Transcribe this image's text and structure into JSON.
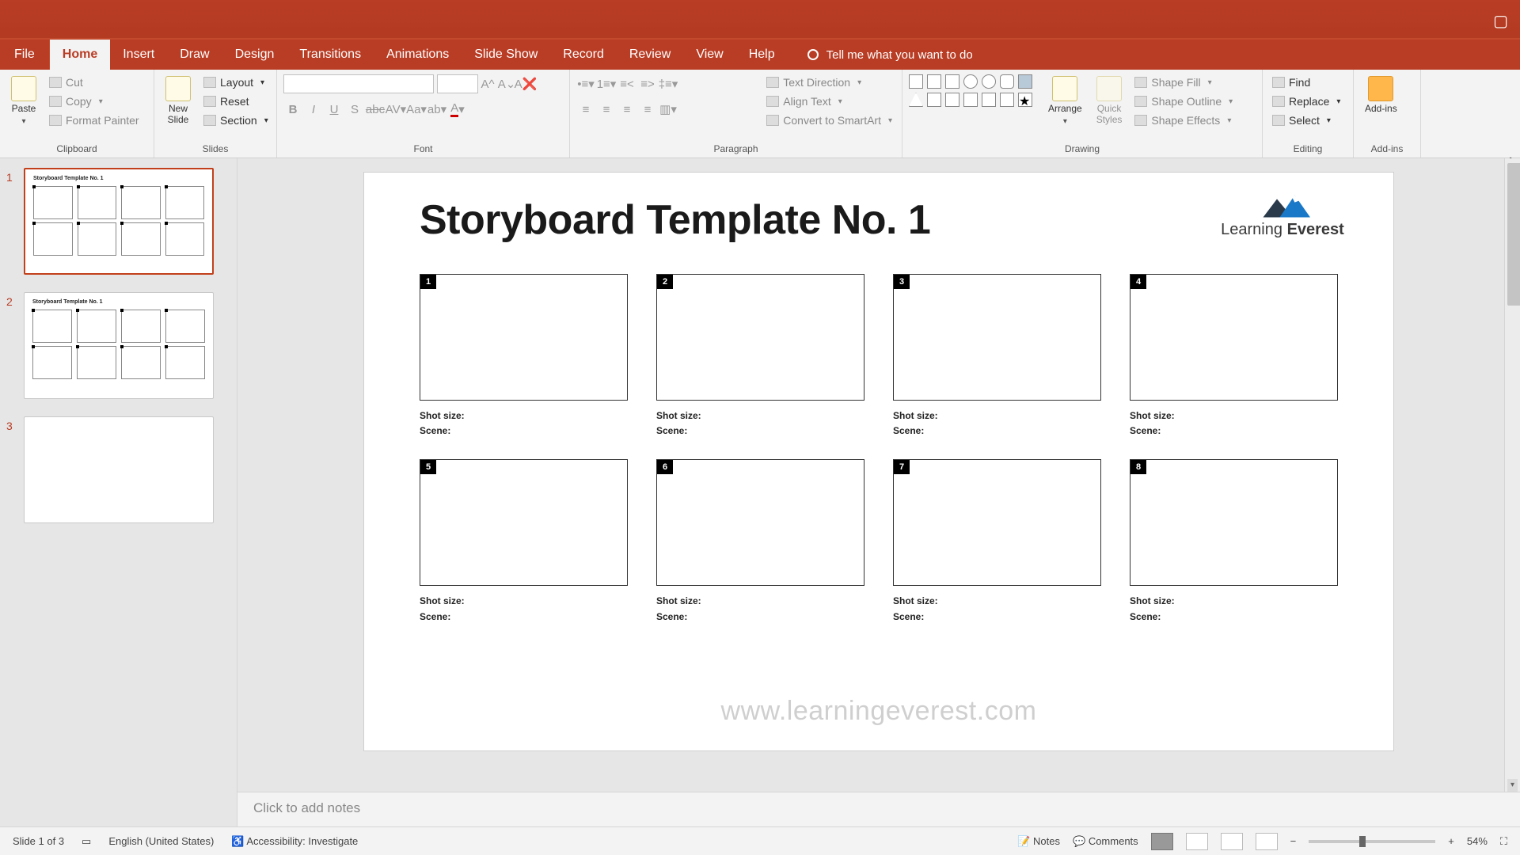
{
  "tabs": {
    "file": "File",
    "home": "Home",
    "insert": "Insert",
    "draw": "Draw",
    "design": "Design",
    "transitions": "Transitions",
    "animations": "Animations",
    "slideShow": "Slide Show",
    "record": "Record",
    "review": "Review",
    "view": "View",
    "help": "Help",
    "tellMe": "Tell me what you want to do"
  },
  "ribbon": {
    "clipboard": {
      "label": "Clipboard",
      "paste": "Paste",
      "cut": "Cut",
      "copy": "Copy",
      "formatPainter": "Format Painter"
    },
    "slides": {
      "label": "Slides",
      "newSlide": "New\nSlide",
      "layout": "Layout",
      "reset": "Reset",
      "section": "Section"
    },
    "font": {
      "label": "Font"
    },
    "para": {
      "label": "Paragraph",
      "textDirection": "Text Direction",
      "alignText": "Align Text",
      "smartArt": "Convert to SmartArt"
    },
    "drawing": {
      "label": "Drawing",
      "arrange": "Arrange",
      "quickStyles": "Quick\nStyles",
      "shapeFill": "Shape Fill",
      "shapeOutline": "Shape Outline",
      "shapeEffects": "Shape Effects"
    },
    "editing": {
      "label": "Editing",
      "find": "Find",
      "replace": "Replace",
      "select": "Select"
    },
    "addins": {
      "label": "Add-ins",
      "btn": "Add-ins"
    }
  },
  "thumbs": [
    {
      "num": "1",
      "title": "Storyboard Template No. 1",
      "layout": "storyboard",
      "active": true
    },
    {
      "num": "2",
      "title": "Storyboard Template No. 1",
      "layout": "storyboard",
      "active": false
    },
    {
      "num": "3",
      "title": "",
      "layout": "blank",
      "active": false
    }
  ],
  "slide": {
    "title": "Storyboard Template No. 1",
    "logoText": "Learning ",
    "logoBold": "Everest",
    "meta": {
      "shot": "Shot size:",
      "scene": "Scene:"
    },
    "cells": [
      "1",
      "2",
      "3",
      "4",
      "5",
      "6",
      "7",
      "8"
    ],
    "watermark": "www.learningeverest.com"
  },
  "notes": {
    "placeholder": "Click to add notes"
  },
  "status": {
    "slide": "Slide 1 of 3",
    "language": "English (United States)",
    "accessibility": "Accessibility: Investigate",
    "notes": "Notes",
    "comments": "Comments",
    "zoom": "54%"
  }
}
